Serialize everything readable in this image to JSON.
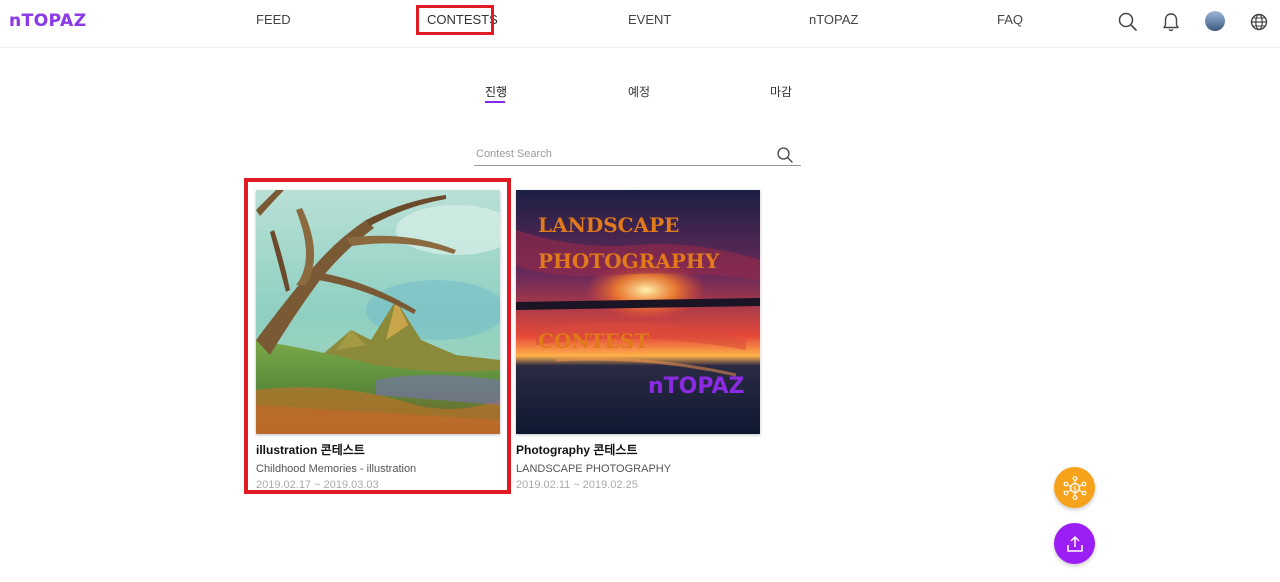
{
  "header": {
    "logo": "nTOPAZ",
    "nav": [
      {
        "label": "FEED"
      },
      {
        "label": "CONTESTS"
      },
      {
        "label": "EVENT"
      },
      {
        "label": "nTOPAZ"
      },
      {
        "label": "FAQ"
      }
    ],
    "icons": [
      "search-icon",
      "bell-icon",
      "avatar",
      "globe-icon"
    ]
  },
  "tabs": [
    {
      "label": "진행"
    },
    {
      "label": "예정"
    },
    {
      "label": "마감"
    }
  ],
  "search": {
    "placeholder": "Contest Search",
    "value": ""
  },
  "contests": [
    {
      "title": "illustration 콘테스트",
      "subtitle": "Childhood Memories - illustration",
      "date": "2019.02.17 ~ 2019.03.03"
    },
    {
      "title": "Photography 콘테스트",
      "subtitle": "LANDSCAPE PHOTOGRAPHY",
      "date": "2019.02.11 ~ 2019.02.25",
      "poster_lines": [
        "LANDSCAPE",
        "PHOTOGRAPHY",
        "CONTEST"
      ],
      "poster_logo": "nTOPAZ"
    }
  ],
  "colors": {
    "accent": "#7a2be2",
    "highlight": "#e01b24",
    "fab_orange": "#f7a21b",
    "fab_purple": "#9b1ef5"
  }
}
